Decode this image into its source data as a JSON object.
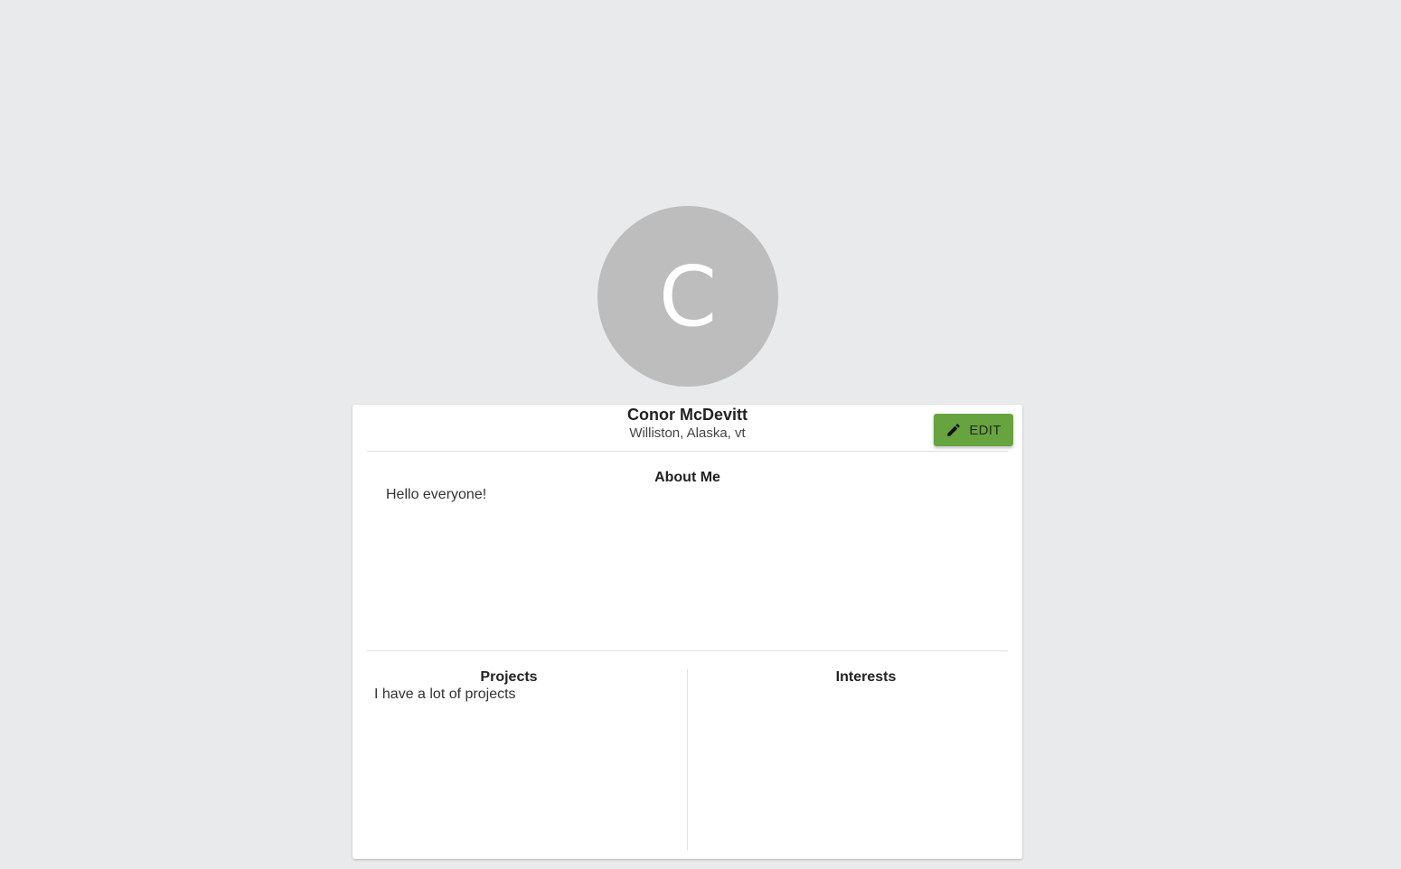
{
  "profile": {
    "avatar_letter": "C",
    "name": "Conor McDevitt",
    "location": "Williston, Alaska, vt"
  },
  "actions": {
    "edit_label": "EDIT",
    "edit_icon": "pencil-icon",
    "edit_color": "#67a43f"
  },
  "about": {
    "title": "About Me",
    "text": "Hello everyone!"
  },
  "projects": {
    "title": "Projects",
    "text": "I have a lot of projects"
  },
  "interests": {
    "title": "Interests"
  },
  "colors": {
    "background": "#e9eaec",
    "avatar": "#bdbdbd",
    "card": "#ffffff"
  }
}
